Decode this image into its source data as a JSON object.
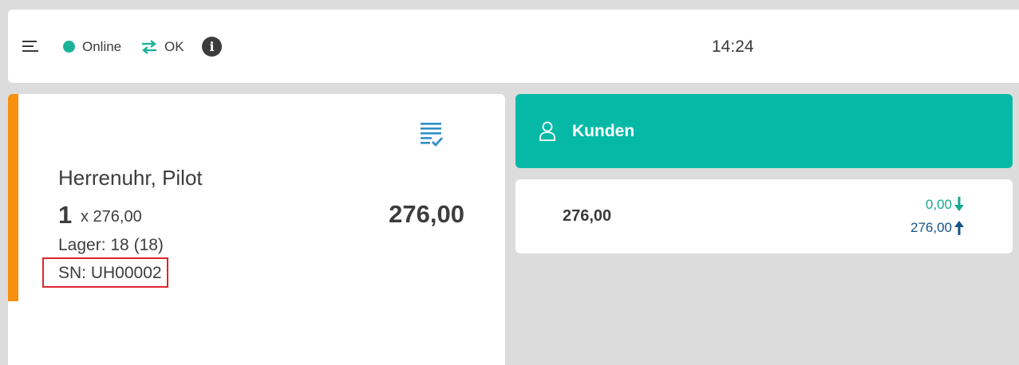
{
  "header": {
    "status_label": "Online",
    "sync_label": "OK",
    "clock": "14:24",
    "status_color": "#1ab39a"
  },
  "item": {
    "name": "Herrenuhr, Pilot",
    "quantity": "1",
    "unit_price": "x 276,00",
    "total": "276,00",
    "stock": "Lager: 18 (18)",
    "serial": "SN: UH00002",
    "accent_color": "#f7900e"
  },
  "customer": {
    "label": "Kunden",
    "color": "#06b9a6"
  },
  "totals": {
    "sum": "276,00",
    "given": "0,00",
    "change": "276,00"
  },
  "icons": [
    "menu-icon",
    "sync-icon",
    "info-icon",
    "list-check-icon",
    "user-icon",
    "arrow-down-icon",
    "arrow-up-icon"
  ]
}
